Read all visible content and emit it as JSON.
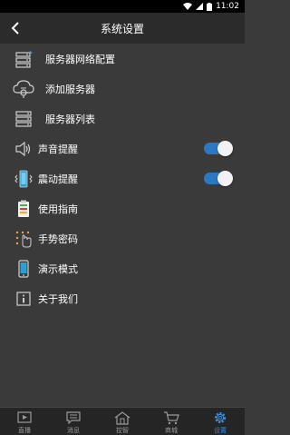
{
  "status_bar": {
    "time": "11:02"
  },
  "header": {
    "title": "系统设置"
  },
  "menu": {
    "items": [
      {
        "label": "服务器网络配置"
      },
      {
        "label": "添加服务器"
      },
      {
        "label": "服务器列表"
      },
      {
        "label": "声音提醒",
        "toggle": true,
        "toggle_on": true
      },
      {
        "label": "震动提醒",
        "toggle": true,
        "toggle_on": true
      },
      {
        "label": "使用指南"
      },
      {
        "label": "手势密码"
      },
      {
        "label": "演示模式"
      },
      {
        "label": "关于我们"
      }
    ]
  },
  "bottom_nav": {
    "items": [
      {
        "label": "直播"
      },
      {
        "label": "消息"
      },
      {
        "label": "控智"
      },
      {
        "label": "商城"
      },
      {
        "label": "设置",
        "active": true
      }
    ]
  },
  "colors": {
    "background": "#3a3a3a",
    "header": "#2b2b2b",
    "toggle_on": "#2b78c5",
    "nav_active": "#3b88d8",
    "nav_inactive": "#9a9a9a"
  }
}
